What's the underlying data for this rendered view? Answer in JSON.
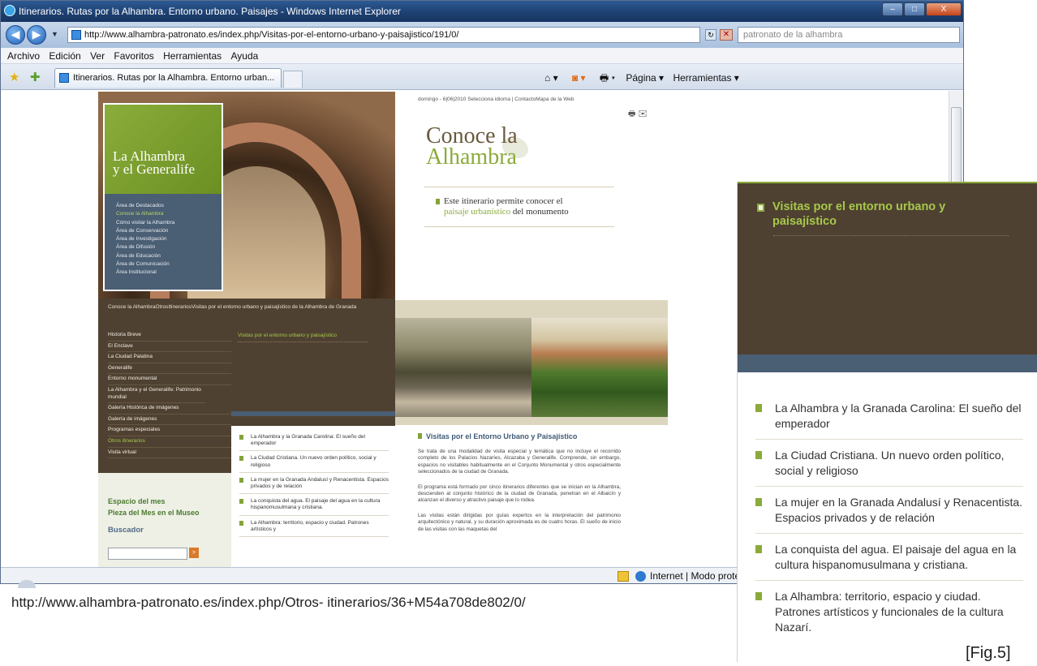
{
  "window": {
    "title": "Itinerarios. Rutas por la Alhambra. Entorno urbano. Paisajes - Windows Internet Explorer",
    "btn_min": "–",
    "btn_max": "□",
    "btn_close": "X"
  },
  "addressbar": {
    "url": "http://www.alhambra-patronato.es/index.php/Visitas-por-el-entorno-urbano-y-paisajistico/191/0/",
    "search_value": "patronato de la alhambra",
    "back": "◀",
    "forward": "▶"
  },
  "menu": [
    "Archivo",
    "Edición",
    "Ver",
    "Favoritos",
    "Herramientas",
    "Ayuda"
  ],
  "tab": {
    "label": "Itinerarios. Rutas por la Alhambra. Entorno urban..."
  },
  "commandbar": {
    "page": "Página ▾",
    "tools": "Herramientas ▾"
  },
  "statusbar": {
    "zone": "Internet | Modo prote"
  },
  "site": {
    "brand_line1": "La Alhambra",
    "brand_line2": "y el Generalife",
    "side_menu": [
      "Área de Destacados",
      "Conoce la Alhambra",
      "Cómo visitar la Alhambra",
      "Área de Conservación",
      "Área de Investigación",
      "Área de Difusión",
      "Área de Educación",
      "Área de Comunicación",
      "Área Institucional"
    ],
    "breadcrumb": "Conoce la AlhambraOtrosItinerariosVisitas por el entorno urbano y paisajístico de la Alhambra de Granada",
    "left_nav": [
      "Historia Breve",
      "El Enclave",
      "La Ciudad Palatina",
      "Generalife",
      "Entorno monumental",
      "La Alhambra y el Generalife: Patrimonio mundial",
      "Galería Histórica de imágenes",
      "Galería de imágenes",
      "Programas especiales",
      "Otros itinerarios",
      "Visita virtual"
    ],
    "mid_heading": "Visitas por el entorno urbano y paisajístico",
    "espacio": "Espacio del mes",
    "pieza": "Pieza del Mes en el Museo",
    "buscador": "Buscador",
    "buscador_go": ">",
    "mid_list": [
      "La Alhambra y la Granada Carolina: El sueño del emperador",
      "La Ciudad Cristiana. Un nuevo orden político, social y religioso",
      "La mujer en la Granada Andalusí y Renacentista. Espacios privados y de relación",
      "La conquista del agua. El paisaje del agua en la cultura hispanomusulmana y cristiana.",
      "La Alhambra: territorio, espacio y ciudad. Patrones artísticos y"
    ],
    "top_info": "domingo - 6|06|2010        Selecciona idioma   |  ContactoMapa de la Web",
    "top_icons": "🖶 ✉",
    "conoce_line1": "Conoce la",
    "conoce_line2": "Alhambra",
    "intro_line1": "Este itinerario permite conocer el",
    "intro_green": "paisaje urbanístico",
    "intro_rest": " del monumento",
    "article_title": "Visitas por el Entorno Urbano y Paisajístico",
    "article_p1": "Se trata de una modalidad de visita especial y temática que no incluye el recorrido completo de los Palacios Nazaríes, Alcazaba y Generalife. Comprende, sin embargo, espacios no visitables habitualmente en el Conjunto Monumental y otros especialmente seleccionados de la ciudad de Granada.",
    "article_p2": "El programa está formado por cinco itinerarios diferentes que se inician en la Alhambra, descienden al conjunto histórico de la ciudad de Granada, penetran en el Albaicín y alcanzan el diverso y atractivo paisaje que lo rodea.",
    "article_p3": "Las visitas están dirigidas por guías expertos en la interpretación del patrimonio arquitectónico y natural, y su duración aproximada es de cuatro horas. El sueño de inicio de las visitas con las maquetas del"
  },
  "zoom": {
    "heading": "Visitas por el entorno urbano y paisajístico",
    "items": [
      "La Alhambra y la Granada Carolina: El sueño del emperador",
      "La Ciudad Cristiana. Un nuevo orden político, social y religioso",
      "La mujer en la Granada Andalusí y Renacentista. Espacios privados y de relación",
      "La conquista del agua. El paisaje del agua en la cultura hispanomusulmana y cristiana.",
      "La Alhambra: territorio, espacio y ciudad. Patrones artísticos y funcionales de la cultura Nazarí."
    ]
  },
  "caption": "http://www.alhambra-patronato.es/index.php/Otros- itinerarios/36+M54a708de802/0/",
  "fig_label": "[Fig.5]",
  "colors": {
    "green": "#8aab3a",
    "brown": "#4f4131",
    "slate": "#4a5e74",
    "ie_blue": "#1d3f70"
  }
}
